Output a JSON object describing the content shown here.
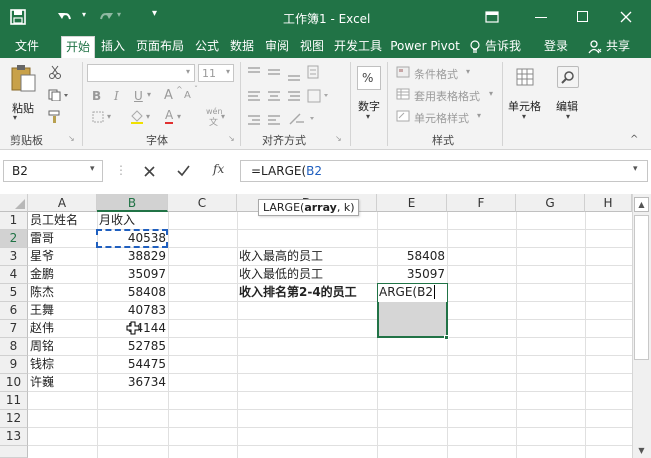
{
  "window": {
    "title": "工作簿1 - Excel"
  },
  "menu": {
    "tabs": [
      "文件",
      "开始",
      "插入",
      "页面布局",
      "公式",
      "数据",
      "审阅",
      "视图",
      "开发工具",
      "Power Pivot"
    ],
    "tell_me": "告诉我",
    "login": "登录",
    "share": "共享"
  },
  "ribbon": {
    "clipboard": {
      "paste": "粘贴",
      "label": "剪贴板"
    },
    "font": {
      "size": "11",
      "bold": "B",
      "italic": "I",
      "underline": "U",
      "grow": "A",
      "shrink": "A",
      "wen": "wén",
      "label": "字体"
    },
    "align": {
      "label": "对齐方式"
    },
    "number": {
      "percent": "%",
      "label": "数字"
    },
    "styles": {
      "cond": "条件格式",
      "table": "套用表格格式",
      "cell": "单元格样式",
      "label": "样式"
    },
    "cells": {
      "label": "单元格"
    },
    "editing": {
      "label": "编辑"
    }
  },
  "formula_bar": {
    "name_box": "B2",
    "fx": "fx",
    "formula_prefix": "=LARGE(",
    "formula_ref": "B2",
    "tooltip_prefix": "LARGE(",
    "tooltip_bold": "array",
    "tooltip_suffix": ", k)"
  },
  "sheet": {
    "columns": [
      "A",
      "B",
      "C",
      "D",
      "E",
      "F",
      "G",
      "H"
    ],
    "rows": [
      "1",
      "2",
      "3",
      "4",
      "5",
      "6",
      "7",
      "8",
      "9",
      "10",
      "11",
      "12",
      "13"
    ],
    "A": [
      "员工姓名",
      "雷哥",
      "星爷",
      "金鹏",
      "陈杰",
      "王舞",
      "赵伟",
      "周铭",
      "钱棕",
      "许巍"
    ],
    "B": [
      "月收入",
      "40538",
      "38829",
      "35097",
      "58408",
      "40783",
      "54144",
      "52785",
      "54475",
      "36734"
    ],
    "D": [
      "收入最高的员工",
      "收入最低的员工",
      "收入排名第2-4的员工"
    ],
    "E": [
      "58408",
      "35097"
    ],
    "E5_edit": "ARGE(B2"
  },
  "colors": {
    "excel_green": "#217346",
    "ribbon_bg": "#f3f3f3",
    "ref_blue": "#1f5fbf"
  }
}
